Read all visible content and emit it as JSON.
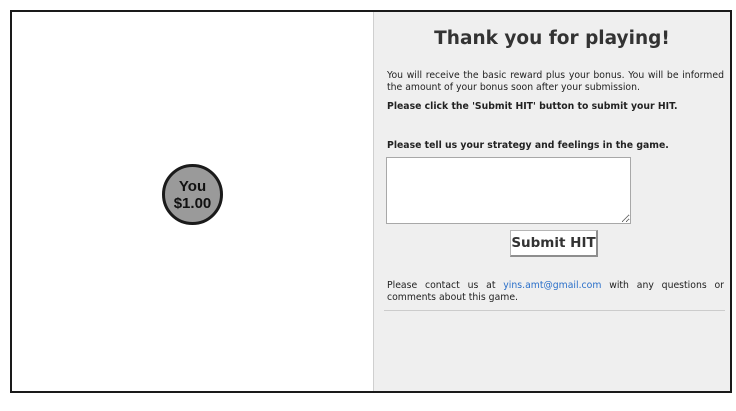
{
  "game": {
    "player_label": "You",
    "player_amount": "$1.00",
    "colors": {
      "node_fill": "#9a9a9a",
      "node_border": "#1a1a1a",
      "panel_bg": "#efefef",
      "link": "#2a6fc9"
    }
  },
  "panel": {
    "title": "Thank you for playing!",
    "info_text": "You will receive the basic reward plus your bonus. You will be informed the amount of your bonus soon after your submission.",
    "submit_note": "Please click the 'Submit HIT' button to submit your HIT.",
    "strategy_label": "Please tell us your strategy and feelings in the game.",
    "strategy_value": "",
    "submit_label": "Submit HIT",
    "contact_prefix": "Please contact us at ",
    "contact_email": "yins.amt@gmail.com",
    "contact_suffix": " with any questions or comments about this game."
  }
}
